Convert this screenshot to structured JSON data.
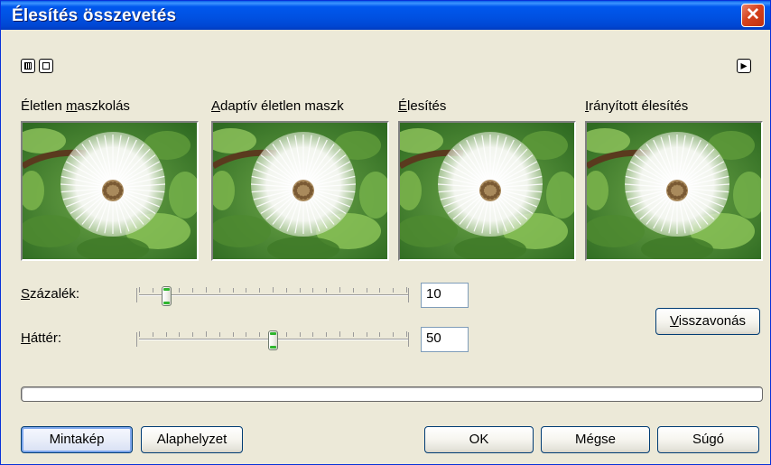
{
  "window": {
    "title": "Élesítés összevetés",
    "close_glyph": "✕"
  },
  "toolbar": {
    "left_icons": [
      "tile-view-icon",
      "single-view-icon"
    ],
    "right_icon": "play-arrow-icon",
    "arrow_glyph": "▸"
  },
  "previews": [
    {
      "accel": "",
      "label_before": "Életlen ",
      "label_accel": "m",
      "label_after": "aszkolás"
    },
    {
      "label_before": "",
      "label_accel": "A",
      "label_after": "daptív életlen maszk"
    },
    {
      "label_before": "",
      "label_accel": "É",
      "label_after": "lesítés"
    },
    {
      "label_before": "",
      "label_accel": "I",
      "label_after": "rányított élesítés"
    }
  ],
  "sliders": [
    {
      "label_accel": "S",
      "label_after": "zázalék:",
      "value": "10",
      "position_percent": 10
    },
    {
      "label_accel": "H",
      "label_after": "áttér:",
      "value": "50",
      "position_percent": 50
    }
  ],
  "buttons": {
    "undo_accel": "V",
    "undo_rest": "isszavonás",
    "sample": "Mintakép",
    "reset": "Alaphelyzet",
    "ok": "OK",
    "cancel": "Mégse",
    "help": "Súgó"
  },
  "progress": {
    "value_percent": 0
  },
  "colors": {
    "title_bar": "#0054E3",
    "close_button": "#D5411C",
    "dialog_bg": "#ECE9D8",
    "slider_accent": "#2EB52E"
  }
}
